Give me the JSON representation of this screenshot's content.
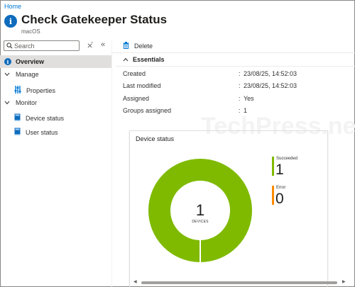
{
  "breadcrumb": {
    "home": "Home"
  },
  "header": {
    "icon": "info-icon",
    "title": "Check Gatekeeper Status",
    "more": "···",
    "subtitle": "macOS"
  },
  "search": {
    "placeholder": "Search",
    "value": ""
  },
  "sidebar": {
    "overview": "Overview",
    "groups": [
      {
        "label": "Manage",
        "items": [
          {
            "label": "Properties",
            "icon": "properties-icon"
          }
        ]
      },
      {
        "label": "Monitor",
        "items": [
          {
            "label": "Device status",
            "icon": "book-icon"
          },
          {
            "label": "User status",
            "icon": "book-icon"
          }
        ]
      }
    ]
  },
  "toolbar": {
    "delete": "Delete"
  },
  "essentials": {
    "title": "Essentials",
    "rows": [
      {
        "key": "Created",
        "value": "23/08/25, 14:52:03"
      },
      {
        "key": "Last modified",
        "value": "23/08/25, 14:52:03"
      },
      {
        "key": "Assigned",
        "value": "Yes"
      },
      {
        "key": "Groups assigned",
        "value": "1"
      }
    ]
  },
  "watermark": "TechPress.net",
  "card": {
    "title": "Device status",
    "total": "1",
    "total_label": "DEVICES",
    "legend": [
      {
        "name": "Succeeded",
        "value": "1",
        "color": "#7fba00"
      },
      {
        "name": "Error",
        "value": "0",
        "color": "#ff8c00"
      }
    ]
  },
  "colors": {
    "accent": "#0078d4",
    "succeeded": "#7fba00",
    "error": "#ff8c00"
  }
}
